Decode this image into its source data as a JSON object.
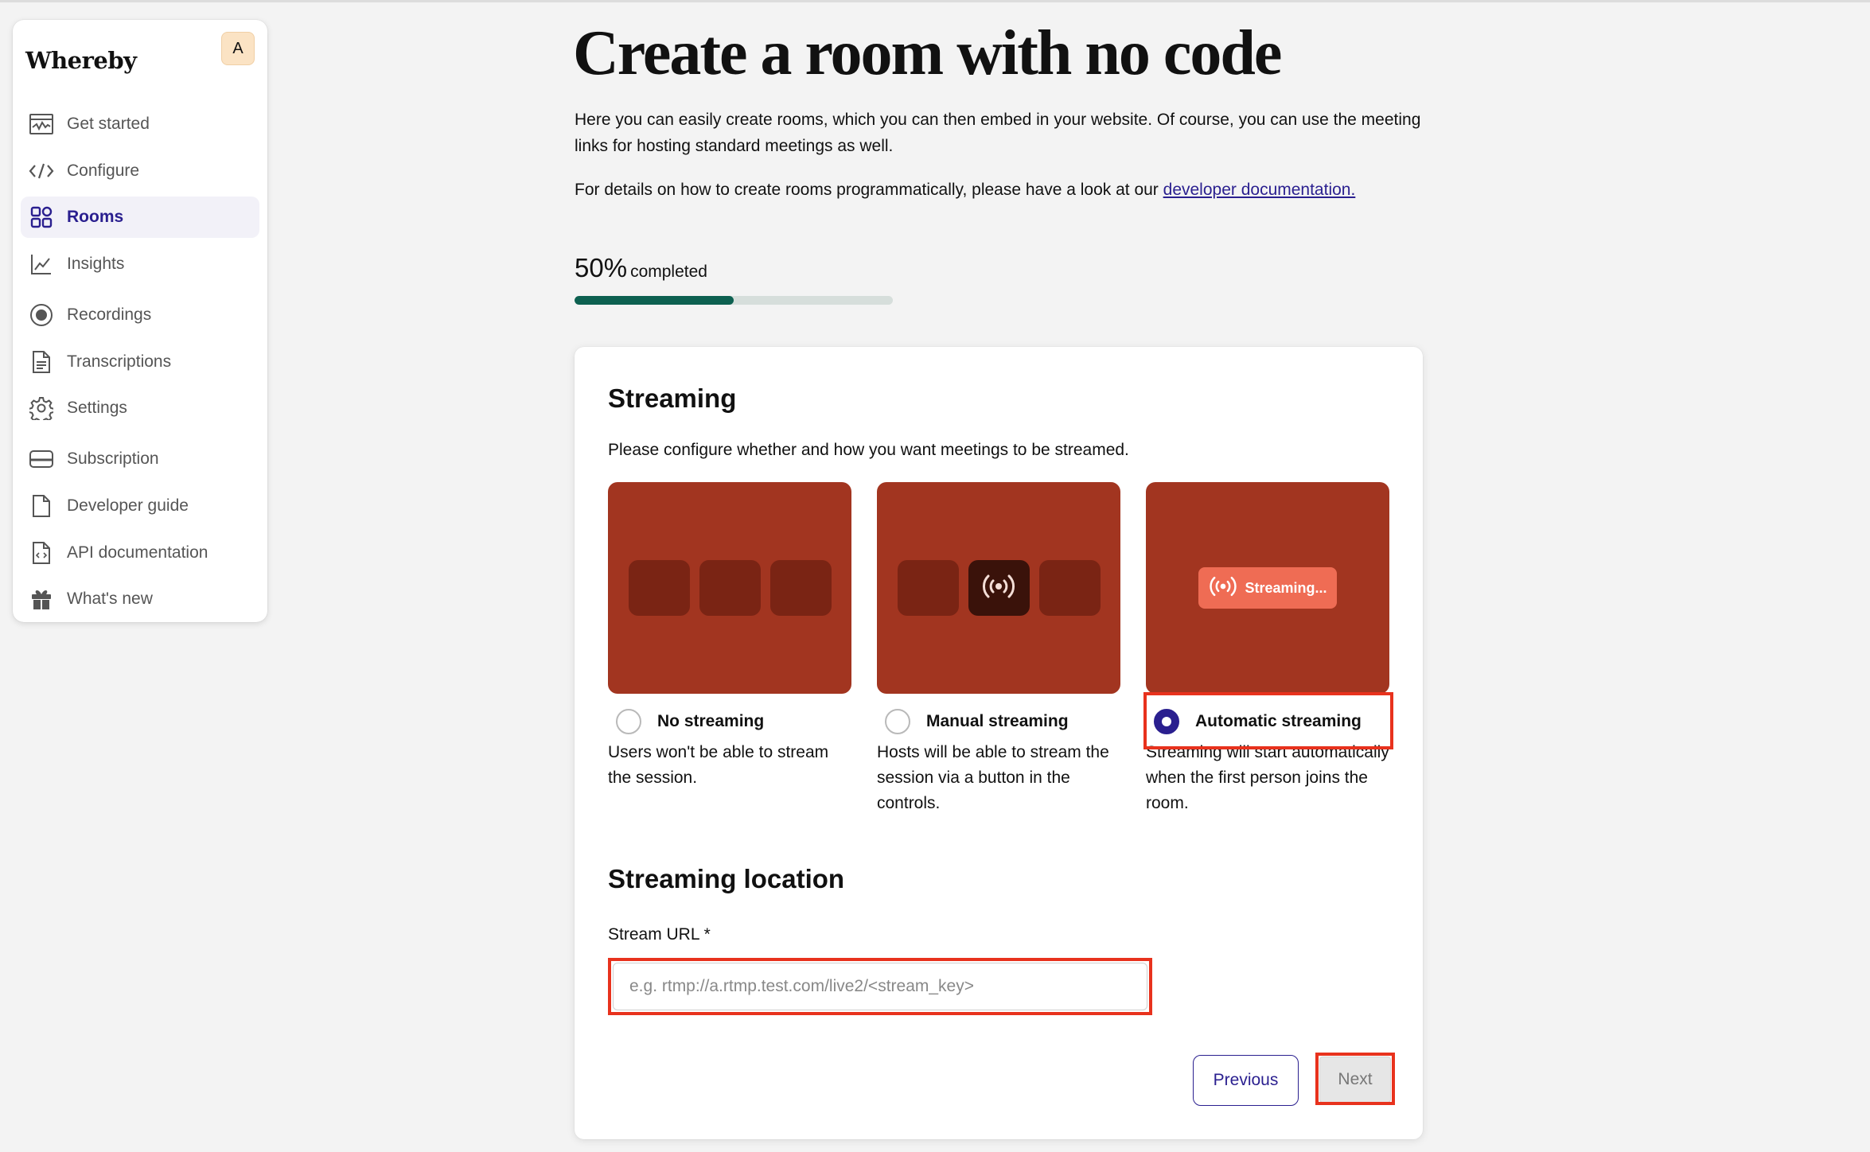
{
  "app": {
    "logo": "Whereby",
    "avatar_initial": "A"
  },
  "sidebar": {
    "items": [
      {
        "label": "Get started",
        "icon": "chart-icon"
      },
      {
        "label": "Configure",
        "icon": "code-icon"
      },
      {
        "label": "Rooms",
        "icon": "grid-icon",
        "active": true
      },
      {
        "label": "Insights",
        "icon": "line-chart-icon"
      },
      {
        "label": "Recordings",
        "icon": "record-icon"
      },
      {
        "label": "Transcriptions",
        "icon": "document-icon"
      },
      {
        "label": "Settings",
        "icon": "gear-icon"
      },
      {
        "label": "Subscription",
        "icon": "card-icon"
      },
      {
        "label": "Developer guide",
        "icon": "file-icon"
      },
      {
        "label": "API documentation",
        "icon": "file-code-icon"
      },
      {
        "label": "What's new",
        "icon": "gift-icon"
      }
    ]
  },
  "main": {
    "title": "Create a room with no code",
    "intro": "Here you can easily create rooms, which you can then embed in your website. Of course, you can use the meeting links for hosting standard meetings as well.",
    "details_prefix": "For details on how to create rooms programmatically, please have a look at our ",
    "details_link": "developer documentation.",
    "progress": {
      "percent_label": "50%",
      "completed_word": "completed",
      "value": 0.5
    }
  },
  "card": {
    "heading": "Streaming",
    "description": "Please configure whether and how you want meetings to be streamed.",
    "options": [
      {
        "label": "No streaming",
        "description": "Users won't be able to stream the session.",
        "selected": false
      },
      {
        "label": "Manual streaming",
        "description": "Hosts will be able to stream the session via a button in the controls.",
        "selected": false
      },
      {
        "label": "Automatic streaming",
        "description": "Streaming will start automatically when the first person joins the room.",
        "selected": true
      }
    ],
    "streaming_badge": "Streaming...",
    "location_heading": "Streaming location",
    "stream_url_label": "Stream URL *",
    "stream_url_placeholder": "e.g. rtmp://a.rtmp.test.com/live2/<stream_key>",
    "stream_url_value": "",
    "previous_label": "Previous",
    "next_label": "Next"
  },
  "colors": {
    "brand": "#2a1f8f",
    "progress": "#0d6050",
    "preview_bg": "#a23520",
    "highlight": "#e8321d"
  }
}
